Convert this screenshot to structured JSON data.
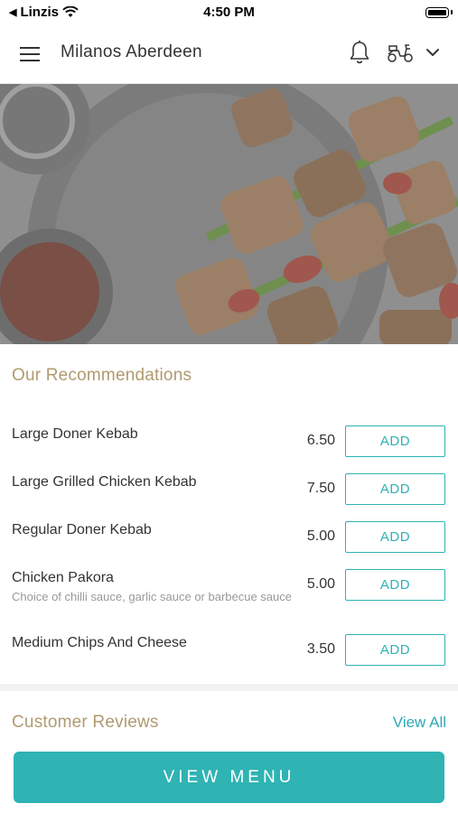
{
  "status_bar": {
    "carrier": "Linzis",
    "time": "4:50 PM"
  },
  "header": {
    "title": "Milanos Aberdeen"
  },
  "recommendations": {
    "title": "Our Recommendations",
    "add_label": "ADD",
    "items": [
      {
        "name": "Large Doner Kebab",
        "description": "",
        "price": "6.50"
      },
      {
        "name": "Large Grilled Chicken Kebab",
        "description": "",
        "price": "7.50"
      },
      {
        "name": "Regular Doner Kebab",
        "description": "",
        "price": "5.00"
      },
      {
        "name": "Chicken Pakora",
        "description": "Choice of chilli sauce, garlic sauce or barbecue sauce",
        "price": "5.00"
      },
      {
        "name": "Medium Chips And Cheese",
        "description": "",
        "price": "3.50"
      }
    ]
  },
  "reviews": {
    "title": "Customer Reviews",
    "view_all": "View All"
  },
  "footer": {
    "view_menu": "VIEW MENU"
  },
  "colors": {
    "accent": "#2fb3b3",
    "section_title": "#b09a70",
    "link": "#2fa8b5"
  },
  "icons": [
    "back-arrow-icon",
    "wifi-icon",
    "battery-icon",
    "hamburger-menu-icon",
    "bell-icon",
    "scooter-icon",
    "chevron-down-icon"
  ]
}
